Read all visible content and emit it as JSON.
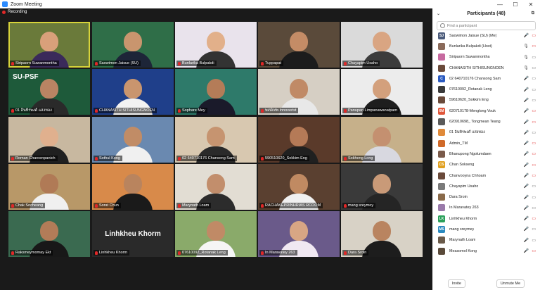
{
  "window": {
    "title": "Zoom Meeting",
    "minimize": "—",
    "maximize": "☐",
    "close": "✕"
  },
  "recording": {
    "label": "Recording"
  },
  "tiles": [
    {
      "name": "Siripaorn Suwanmontha",
      "bg": "#6a7a3a",
      "skin": "#d9a07a",
      "shirt": "#3a2a5a",
      "active": true
    },
    {
      "name": "Saowimon Jaisue (SU)",
      "bg": "#2f6e48",
      "skin": "#c9956e",
      "shirt": "#1d2538"
    },
    {
      "name": "Bunlarika Bulpakdi",
      "bg": "#e9e3ec",
      "skin": "#e2b08a",
      "shirt": "#333"
    },
    {
      "name": "Tuppapat",
      "bg": "#5a4a3a",
      "skin": "#c48c66",
      "shirt": "#1c1c1c"
    },
    {
      "name": "Chayapim Usaho",
      "bg": "#dadada",
      "skin": "#d9a582",
      "shirt": "#3c3c3c"
    },
    {
      "name": "01 อินทิรพงศ์ แสงทอง",
      "bg": "#1e5a3a",
      "skin": "#b98463",
      "shirt": "#2a2a2a",
      "overlay": "SU-PSF"
    },
    {
      "name": "CHANASITH SITHISUNGNOEN",
      "bg": "#1f3f8a",
      "skin": "#c9956e",
      "shirt": "#f2f2f2"
    },
    {
      "name": "Sophare Mey",
      "bg": "#2e7a6a",
      "skin": "#b47c58",
      "shirt": "#1a1a2a"
    },
    {
      "name": "พงษ์เทพ Innoverist",
      "bg": "#d6cfc4",
      "skin": "#c08a66",
      "shirt": "#e8e8e8"
    },
    {
      "name": "Panupan Limpanawanatpam",
      "bg": "#ececec",
      "skin": "#d3a07c",
      "shirt": "#1e1e1e"
    },
    {
      "name": "Roman Charoenpanich",
      "bg": "#c8b8a0",
      "skin": "#e0b08e",
      "shirt": "#202020"
    },
    {
      "name": "Sothul Kong",
      "bg": "#6a89b0",
      "skin": "#c18c66",
      "shirt": "#f0f0f0"
    },
    {
      "name": "02 640710176 Chansong Sam",
      "bg": "#d8c8b0",
      "skin": "#c69470",
      "shirt": "#2a2a2a"
    },
    {
      "name": "590510620_Sokkim Eng",
      "bg": "#5a3a2a",
      "skin": "#b57a57",
      "shirt": "#202020"
    },
    {
      "name": "Sokheng Long",
      "bg": "#c6b08a",
      "skin": "#c49070",
      "shirt": "#d8d8e0"
    },
    {
      "name": "Chak Socheang",
      "bg": "#b89868",
      "skin": "#b07a56",
      "shirt": "#f0f0f0"
    },
    {
      "name": "Sorat Chun",
      "bg": "#d88a4a",
      "skin": "#b9845e",
      "shirt": "#1a1a1a"
    },
    {
      "name": "Marynath Loam",
      "bg": "#e2ddd3",
      "skin": "#c28e6c",
      "shirt": "#2c2c2c"
    },
    {
      "name": "RACHAKEPRINHRIAS RCOOM",
      "bg": "#5a4030",
      "skin": "#c08a62",
      "shirt": "#f0f0f0"
    },
    {
      "name": "mang sreymey",
      "bg": "#3a3a3a",
      "skin": "#c99a78",
      "shirt": "#252525"
    },
    {
      "name": "Raksmeymomay Ekt",
      "bg": "#3a6a50",
      "skin": "#b27c58",
      "shirt": "#181818"
    },
    {
      "name": "Linhkheu Khorm",
      "bg": "#2a2a2a",
      "skin": "#2a2a2a",
      "shirt": "#2a2a2a",
      "overlay": "Linhkheu Khorm"
    },
    {
      "name": "07610092_Rotanak Leng",
      "bg": "#8aaa6a",
      "skin": "#c08a66",
      "shirt": "#f5f5f5"
    },
    {
      "name": "In Maravatey 263",
      "bg": "#6a5a8a",
      "skin": "#d8a684",
      "shirt": "#f0e8f2"
    },
    {
      "name": "Dara Sroin",
      "bg": "#d8d2c6",
      "skin": "#b98460",
      "shirt": "#1d1d1d"
    }
  ],
  "panel": {
    "title": "Participants (48)",
    "search_placeholder": "Find a participant",
    "invite": "Invite",
    "unmute_me": "Unmute Me",
    "participants": [
      {
        "name": "Saowimon Jaisue (SU) (Me)",
        "av": "SJ",
        "color": "#4a5a7a",
        "mic": "muted",
        "cam": "off"
      },
      {
        "name": "Bunlarika Bulpakdi (Host)",
        "av": "",
        "color": "#8a6a5a",
        "mic": "on",
        "cam": "off"
      },
      {
        "name": "Siripaorn Suwanmontha",
        "av": "",
        "color": "#c76aa0",
        "mic": "on",
        "cam": "on"
      },
      {
        "name": "CHANASITH SITHISUNGNOEN",
        "av": "",
        "color": "#6a4a3a",
        "mic": "on",
        "cam": "on"
      },
      {
        "name": "02 640710176 Chansong Sam",
        "av": "C",
        "color": "#2a5ac0",
        "mic": "muted",
        "cam": "on"
      },
      {
        "name": "07610092_Rotanak Leng",
        "av": "",
        "color": "#3a3a3a",
        "mic": "muted",
        "cam": "on"
      },
      {
        "name": "59610620_Sokkim Eng",
        "av": "",
        "color": "#6a4a3a",
        "mic": "muted",
        "cam": "on"
      },
      {
        "name": "620710178-Menglong Vouk",
        "av": "6M",
        "color": "#e0563a",
        "mic": "muted",
        "cam": "off"
      },
      {
        "name": "620910698_ Tongmean Teang",
        "av": "",
        "color": "#5a5a5a",
        "mic": "muted",
        "cam": "off"
      },
      {
        "name": "01 อินทิรพงศ์ แสงทอง",
        "av": "",
        "color": "#e08a3a",
        "mic": "muted",
        "cam": "on"
      },
      {
        "name": "Admin_TM",
        "av": "",
        "color": "#d06a2a",
        "mic": "muted",
        "cam": "off"
      },
      {
        "name": "Bhanupong Ngolumdaen",
        "av": "",
        "color": "#7a5a4a",
        "mic": "muted",
        "cam": "off"
      },
      {
        "name": "Chan Sokseng",
        "av": "CS",
        "color": "#e0a020",
        "mic": "muted",
        "cam": "off"
      },
      {
        "name": "Chanvooyna Chhoam",
        "av": "",
        "color": "#6a4a3a",
        "mic": "muted",
        "cam": "off"
      },
      {
        "name": "Chayapim Usaho",
        "av": "",
        "color": "#7a7a7a",
        "mic": "muted",
        "cam": "on"
      },
      {
        "name": "Dara Sroin",
        "av": "",
        "color": "#8a6a4a",
        "mic": "muted",
        "cam": "on"
      },
      {
        "name": "In Maravatey 263",
        "av": "",
        "color": "#9a7aaa",
        "mic": "muted",
        "cam": "on"
      },
      {
        "name": "Linhkheu Khorm",
        "av": "LK",
        "color": "#2aa05a",
        "mic": "muted",
        "cam": "off"
      },
      {
        "name": "mang sreymey",
        "av": "MS",
        "color": "#2a8ac0",
        "mic": "muted",
        "cam": "on"
      },
      {
        "name": "Marynath Loam",
        "av": "",
        "color": "#6a5a4a",
        "mic": "muted",
        "cam": "on"
      },
      {
        "name": "Measomol Kong",
        "av": "",
        "color": "#5a4a3a",
        "mic": "muted",
        "cam": "off"
      }
    ]
  }
}
